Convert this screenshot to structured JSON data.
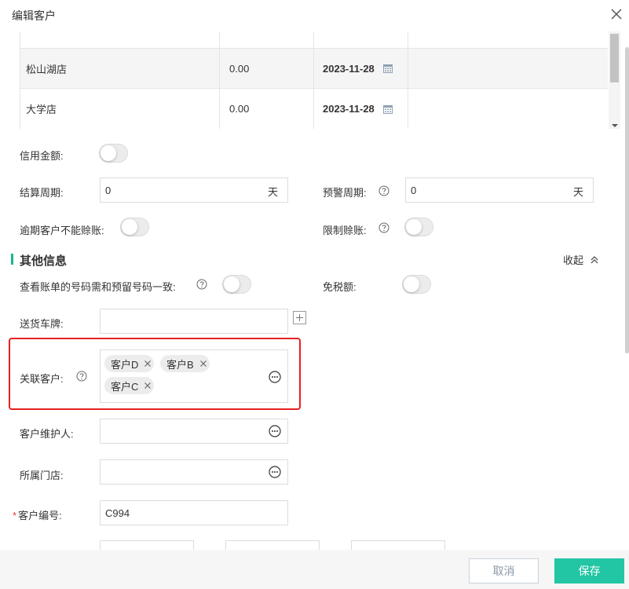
{
  "dialog": {
    "title": "编辑客户"
  },
  "stores": [
    {
      "name": "松山湖店",
      "amount": "0.00",
      "date": "2023-11-28"
    },
    {
      "name": "大学店",
      "amount": "0.00",
      "date": "2023-11-28"
    }
  ],
  "credit": {
    "label": "信用金额:"
  },
  "settlement": {
    "label": "结算周期:",
    "value": "0",
    "unit": "天"
  },
  "warning": {
    "label": "预警周期:",
    "value": "0",
    "unit": "天"
  },
  "overdue": {
    "label": "逾期客户不能赊账:"
  },
  "limit_credit": {
    "label": "限制赊账:"
  },
  "section": {
    "title": "其他信息",
    "collapse_label": "收起"
  },
  "bill_phone": {
    "label": "查看账单的号码需和预留号码一致:"
  },
  "tax_free": {
    "label": "免税额:"
  },
  "plate": {
    "label": "送货车牌:",
    "value": ""
  },
  "related": {
    "label": "关联客户:",
    "tags": [
      "客户D",
      "客户B",
      "客户C"
    ]
  },
  "maintainer": {
    "label": "客户维护人:",
    "value": ""
  },
  "store": {
    "label": "所属门店:",
    "value": ""
  },
  "customer_no": {
    "label": "客户编号:",
    "required": "*",
    "value": "C994"
  },
  "footer": {
    "cancel_label": "取消",
    "save_label": "保存"
  },
  "colors": {
    "accent": "#23c6a4",
    "section_bar": "#19b694",
    "highlight": "#e52222"
  }
}
